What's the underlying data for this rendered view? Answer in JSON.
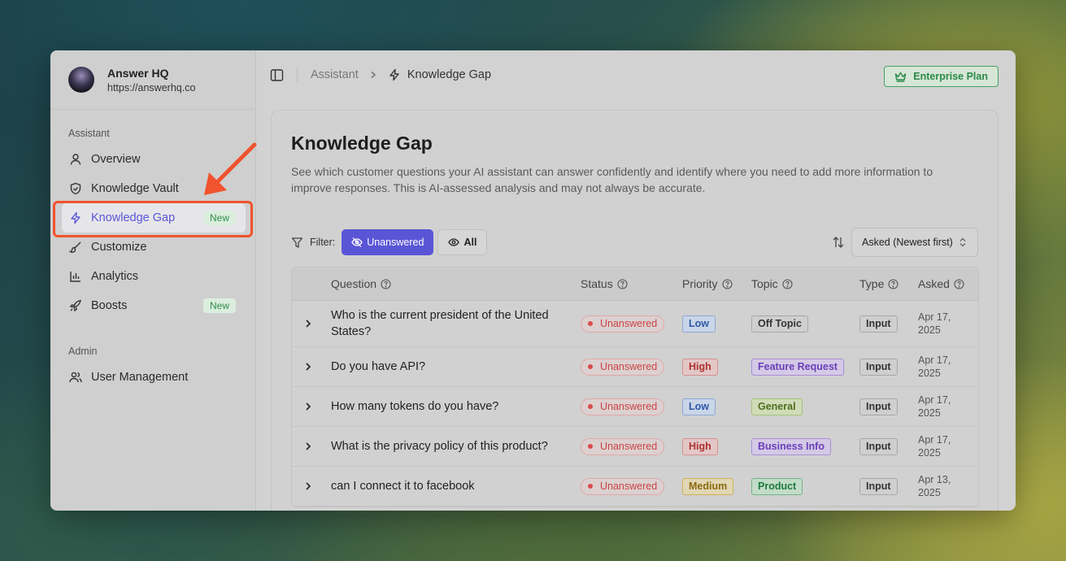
{
  "workspace": {
    "name": "Answer HQ",
    "url": "https://answerhq.co"
  },
  "sidebar": {
    "section_assistant": "Assistant",
    "section_admin": "Admin",
    "items": [
      {
        "label": "Overview",
        "icon": "user-icon"
      },
      {
        "label": "Knowledge Vault",
        "icon": "shield-icon"
      },
      {
        "label": "Knowledge Gap",
        "icon": "lightning-icon",
        "badge": "New",
        "active": true
      },
      {
        "label": "Customize",
        "icon": "brush-icon"
      },
      {
        "label": "Analytics",
        "icon": "bar-chart-icon"
      },
      {
        "label": "Boosts",
        "icon": "rocket-icon",
        "badge": "New"
      },
      {
        "label": "User Management",
        "icon": "users-icon"
      }
    ]
  },
  "header": {
    "breadcrumb_parent": "Assistant",
    "breadcrumb_current": "Knowledge Gap",
    "plan_label": "Enterprise Plan"
  },
  "main": {
    "title": "Knowledge Gap",
    "description": "See which customer questions your AI assistant can answer confidently and identify where you need to add more information to improve responses. This is AI-assessed analysis and may not always be accurate.",
    "filter_label": "Filter:",
    "filter_unanswered": "Unanswered",
    "filter_all": "All",
    "sort_value": "Asked (Newest first)"
  },
  "table": {
    "headers": {
      "question": "Question",
      "status": "Status",
      "priority": "Priority",
      "topic": "Topic",
      "type": "Type",
      "asked": "Asked"
    },
    "rows": [
      {
        "question": "Who is the current president of the United States?",
        "status": "Unanswered",
        "priority": "Low",
        "topic": "Off Topic",
        "type": "Input",
        "asked": "Apr 17, 2025"
      },
      {
        "question": "Do you have API?",
        "status": "Unanswered",
        "priority": "High",
        "topic": "Feature Request",
        "type": "Input",
        "asked": "Apr 17, 2025"
      },
      {
        "question": "How many tokens do you have?",
        "status": "Unanswered",
        "priority": "Low",
        "topic": "General",
        "type": "Input",
        "asked": "Apr 17, 2025"
      },
      {
        "question": "What is the privacy policy of this product?",
        "status": "Unanswered",
        "priority": "High",
        "topic": "Business Info",
        "type": "Input",
        "asked": "Apr 17, 2025"
      },
      {
        "question": "can I connect it to facebook",
        "status": "Unanswered",
        "priority": "Medium",
        "topic": "Product",
        "type": "Input",
        "asked": "Apr 13, 2025"
      }
    ]
  },
  "colors": {
    "accent": "#5a55d6",
    "annotation": "#f0532d",
    "plan_green": "#2b8a4a"
  }
}
